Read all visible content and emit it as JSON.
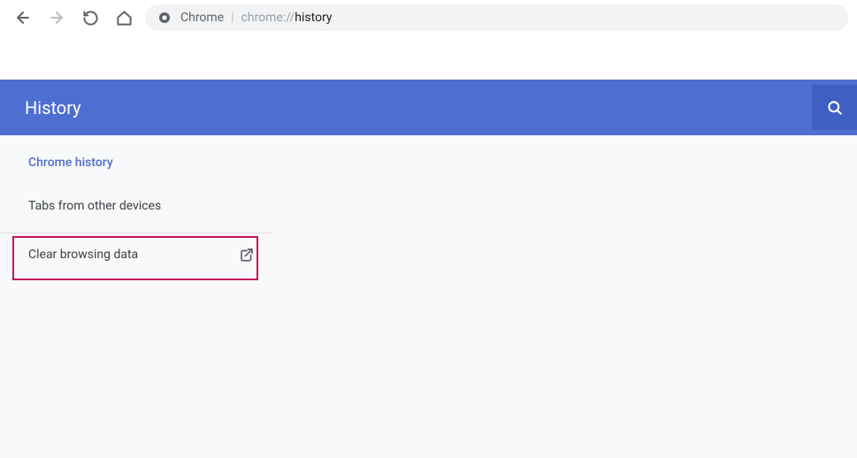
{
  "address": {
    "app_label": "Chrome",
    "path_prefix": "chrome://",
    "path_bold": "history"
  },
  "header": {
    "title": "History"
  },
  "sidebar": {
    "items": [
      {
        "label": "Chrome history"
      },
      {
        "label": "Tabs from other devices"
      },
      {
        "label": "Clear browsing data"
      }
    ]
  }
}
